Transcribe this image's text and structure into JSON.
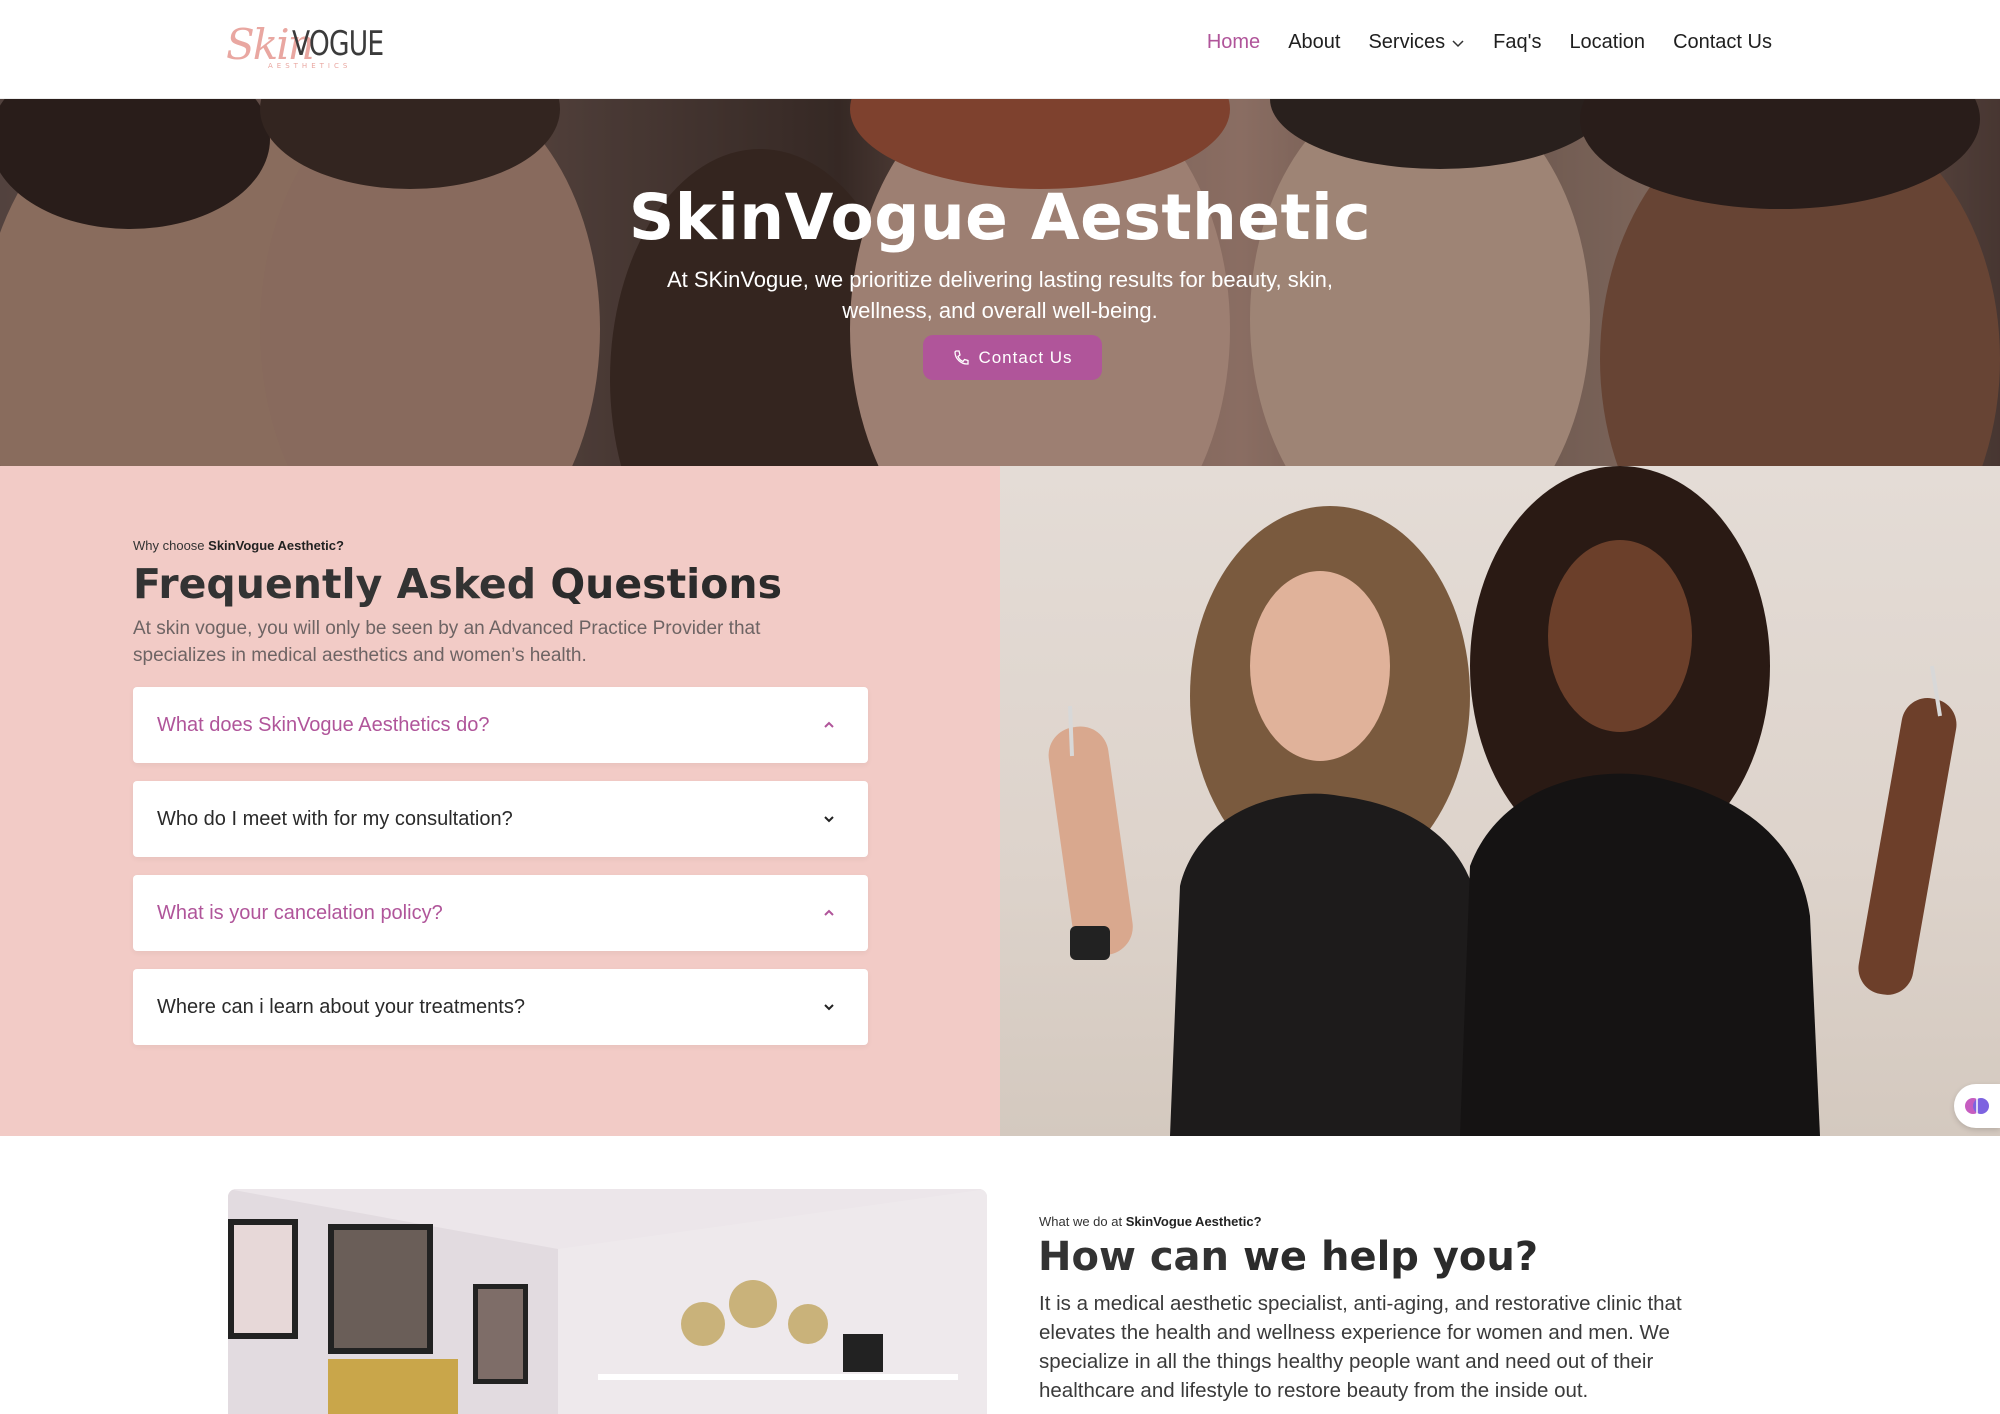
{
  "brand": {
    "logo_script": "Skin",
    "logo_main": "VOGUE",
    "logo_sub": "AESTHETICS",
    "accent_color": "#b0559a",
    "pink_bg": "#f2cbc6"
  },
  "nav": {
    "items": [
      {
        "label": "Home",
        "active": true
      },
      {
        "label": "About"
      },
      {
        "label": "Services",
        "has_dropdown": true
      },
      {
        "label": "Faq's"
      },
      {
        "label": "Location"
      },
      {
        "label": "Contact Us"
      }
    ]
  },
  "hero": {
    "title": "SkinVogue Aesthetic",
    "subtitle": "At SKinVogue, we prioritize delivering lasting results for beauty, skin, wellness, and overall well-being.",
    "button_label": "Contact Us",
    "button_icon": "phone-icon"
  },
  "faq": {
    "eyebrow_prefix": "Why choose ",
    "eyebrow_brand": "SkinVogue Aesthetic?",
    "title_light": "Frequently Asked ",
    "title_bold": "Questions",
    "description": "At skin vogue, you will only be seen by an Advanced Practice Provider that specializes in medical aesthetics and women’s health.",
    "items": [
      {
        "question": "What does SkinVogue Aesthetics do?",
        "open": true
      },
      {
        "question": "Who do I meet with for my consultation?",
        "open": false
      },
      {
        "question": "What is your cancelation policy?",
        "open": true
      },
      {
        "question": "Where can i learn about your treatments?",
        "open": false
      }
    ]
  },
  "help": {
    "eyebrow_prefix": "What we do at ",
    "eyebrow_brand": "SkinVogue Aesthetic?",
    "title_light": "How can ",
    "title_bold": "we help you?",
    "description": "It is a medical aesthetic specialist, anti-aging, and restorative clinic that elevates the health and wellness experience for women and men. We specialize in all the things healthy people want and need out of their healthcare and lifestyle to restore beauty from the inside out."
  },
  "widget": {
    "icon": "brain-icon"
  }
}
